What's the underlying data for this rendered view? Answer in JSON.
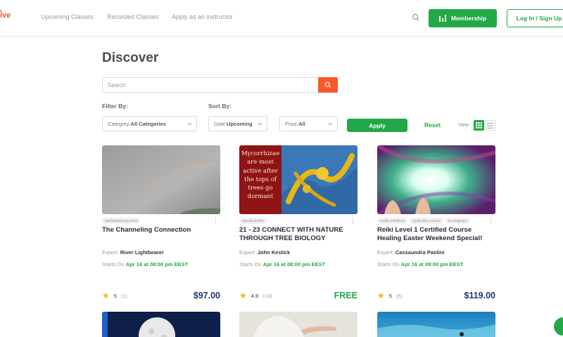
{
  "header": {
    "logo_text": "ive",
    "nav": [
      "Upcoming Classes",
      "Recorded Classes",
      "Apply as an instructor"
    ],
    "membership_label": "Membership",
    "login_label": "Log In / Sign Up"
  },
  "discover": {
    "title": "Discover",
    "search_placeholder": "Search",
    "filter_label": "Filter By:",
    "sort_label": "Sort By:",
    "category": {
      "prefix": "Category:",
      "value": "All Categories"
    },
    "date": {
      "prefix": "Date:",
      "value": "Upcoming"
    },
    "price": {
      "prefix": "Price:",
      "value": "All"
    },
    "apply_label": "Apply",
    "reset_label": "Reset",
    "view_label": "View"
  },
  "cards": [
    {
      "tags": [
        "Spirituality/Energy Work"
      ],
      "title": "The Channeling Connection",
      "expert_label": "Expert:",
      "expert": "River Lightbearer",
      "starts_label": "Starts On",
      "starts": "Apr 16 at 08:00 pm EEST",
      "rating": "5",
      "reviews": "(1)",
      "price": "$97.00"
    },
    {
      "tags": [
        "Education/Other"
      ],
      "image_text": "Mycorrhizae are most active after the tops of trees go dormant",
      "title": "21 - 23 CONNECT WITH NATURE THROUGH TREE BIOLOGY",
      "expert_label": "Expert:",
      "expert": "John Keslick",
      "starts_label": "Starts On",
      "starts": "Apr 16 at 08:00 pm EEST",
      "rating": "4.8",
      "reviews": "(18)",
      "price": "FREE"
    },
    {
      "tags": [
        "Health & Wellness",
        "Certification Courses",
        "For Beginners"
      ],
      "title": "Reiki Level 1 Certified Course Healing Easter Weekend Special!",
      "expert_label": "Expert:",
      "expert": "Cassaundra Paolini",
      "starts_label": "Starts On",
      "starts": "Apr 16 at 09:00 pm EEST",
      "rating": "5",
      "reviews": "(6)",
      "price": "$119.00"
    }
  ],
  "colors": {
    "accent_green": "#22a846",
    "search_orange": "#f45a2b",
    "price_navy": "#27346e",
    "star_yellow": "#f5b90a",
    "logo_orange": "#e8542c"
  },
  "icons": {
    "search": "search-icon",
    "membership": "membership-icon",
    "chevron": "chevron-down-icon",
    "grid": "grid-view-icon",
    "list": "list-view-icon",
    "star": "star-icon",
    "more": "more-vertical-icon",
    "chat": "chat-icon"
  }
}
